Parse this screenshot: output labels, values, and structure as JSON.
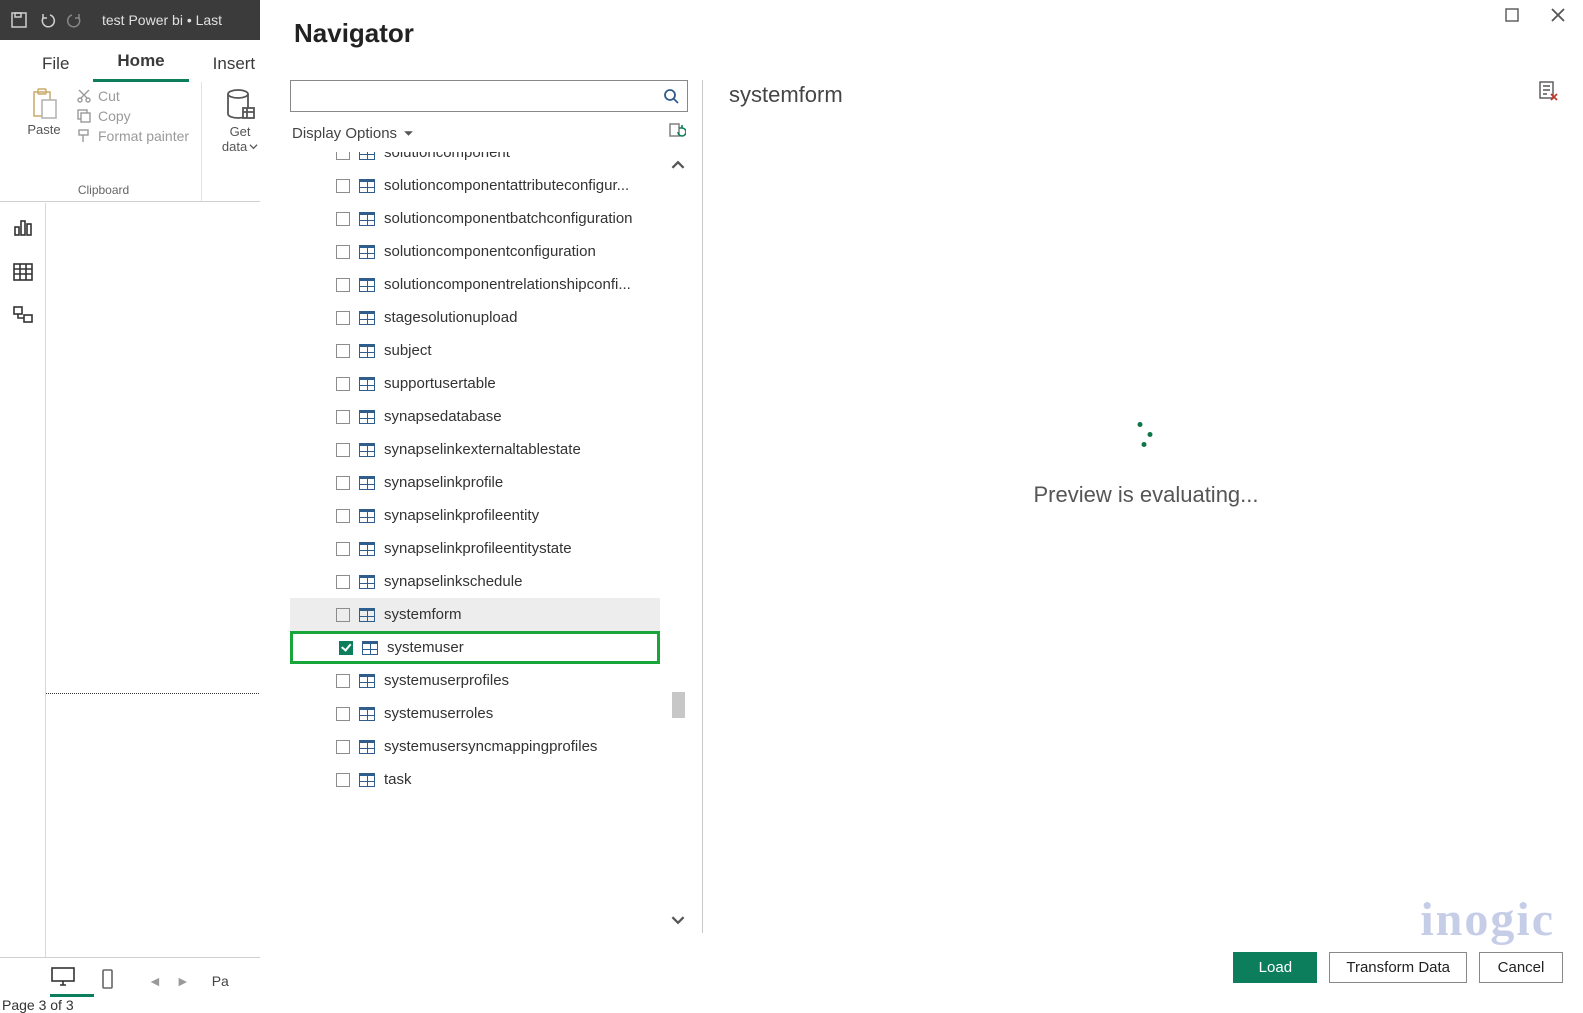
{
  "titlebar": {
    "title": "test Power bi • Last"
  },
  "ribbon": {
    "tabs": {
      "file": "File",
      "home": "Home",
      "insert": "Insert"
    },
    "paste_label": "Paste",
    "cut_label": "Cut",
    "copy_label": "Copy",
    "format_painter_label": "Format painter",
    "clipboard_group": "Clipboard",
    "get_data_label1": "Get",
    "get_data_label2": "data"
  },
  "footer": {
    "page_prefix": "Pa",
    "page_counter": "Page 3 of 3"
  },
  "navigator": {
    "title": "Navigator",
    "display_options": "Display Options",
    "search_placeholder": "",
    "items": [
      {
        "label": "solutioncomponent",
        "checked": false
      },
      {
        "label": "solutioncomponentattributeconfigur...",
        "checked": false
      },
      {
        "label": "solutioncomponentbatchconfiguration",
        "checked": false
      },
      {
        "label": "solutioncomponentconfiguration",
        "checked": false
      },
      {
        "label": "solutioncomponentrelationshipconfi...",
        "checked": false
      },
      {
        "label": "stagesolutionupload",
        "checked": false
      },
      {
        "label": "subject",
        "checked": false
      },
      {
        "label": "supportusertable",
        "checked": false
      },
      {
        "label": "synapsedatabase",
        "checked": false
      },
      {
        "label": "synapselinkexternaltablestate",
        "checked": false
      },
      {
        "label": "synapselinkprofile",
        "checked": false
      },
      {
        "label": "synapselinkprofileentity",
        "checked": false
      },
      {
        "label": "synapselinkprofileentitystate",
        "checked": false
      },
      {
        "label": "synapselinkschedule",
        "checked": false
      },
      {
        "label": "systemform",
        "checked": false,
        "selected": true
      },
      {
        "label": "systemuser",
        "checked": true,
        "highlight": true
      },
      {
        "label": "systemuserprofiles",
        "checked": false
      },
      {
        "label": "systemuserroles",
        "checked": false
      },
      {
        "label": "systemusersyncmappingprofiles",
        "checked": false
      },
      {
        "label": "task",
        "checked": false
      }
    ]
  },
  "preview": {
    "title": "systemform",
    "loading_text": "Preview is evaluating..."
  },
  "buttons": {
    "load": "Load",
    "transform": "Transform Data",
    "cancel": "Cancel"
  },
  "watermark": "inogic"
}
